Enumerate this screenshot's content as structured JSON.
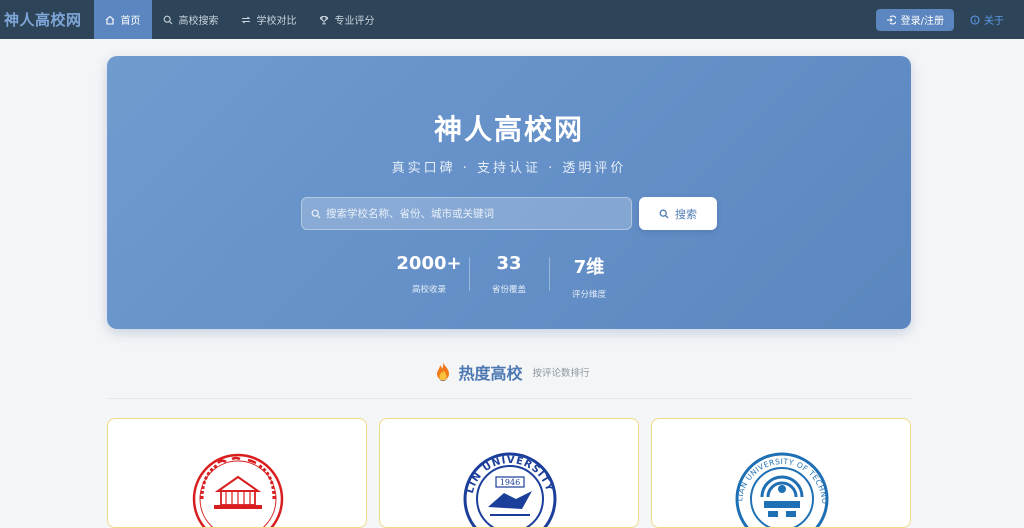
{
  "navbar": {
    "brand": "神人高校网",
    "items": [
      {
        "label": "首页",
        "icon": "home-icon",
        "active": true
      },
      {
        "label": "高校搜索",
        "icon": "search-icon",
        "active": false
      },
      {
        "label": "学校对比",
        "icon": "compare-icon",
        "active": false
      },
      {
        "label": "专业评分",
        "icon": "trophy-icon",
        "active": false
      }
    ],
    "login_label": "登录/注册",
    "about_label": "关于"
  },
  "hero": {
    "title": "神人高校网",
    "subtitle": "真实口碑 · 支持认证 · 透明评价",
    "search_placeholder": "搜索学校名称、省份、城市或关键词",
    "search_button": "搜索",
    "stats": [
      {
        "value": "2000+",
        "label": "高校收录"
      },
      {
        "value": "33",
        "label": "省份覆盖"
      },
      {
        "value": "7维",
        "label": "评分维度"
      }
    ]
  },
  "section": {
    "title": "热度高校",
    "subtitle": "按评论数排行"
  },
  "colors": {
    "navbar": "#2e4458",
    "accent": "#5b86bf",
    "brand": "#7ea6d8",
    "card_border": "#f0d98a"
  },
  "cards": [
    {
      "logo": "red-university-seal-logo",
      "logo_color": "#d81e1e"
    },
    {
      "logo": "blue-university-seal-logo",
      "logo_color": "#1b3e9a",
      "seal_text": "LIN UNIVERSITY",
      "seal_year": "1946"
    },
    {
      "logo": "blue-technology-university-seal-logo",
      "logo_color": "#1f6fb5",
      "seal_text": "LIAN UNIVERSITY OF TECHNOLOGY"
    }
  ]
}
